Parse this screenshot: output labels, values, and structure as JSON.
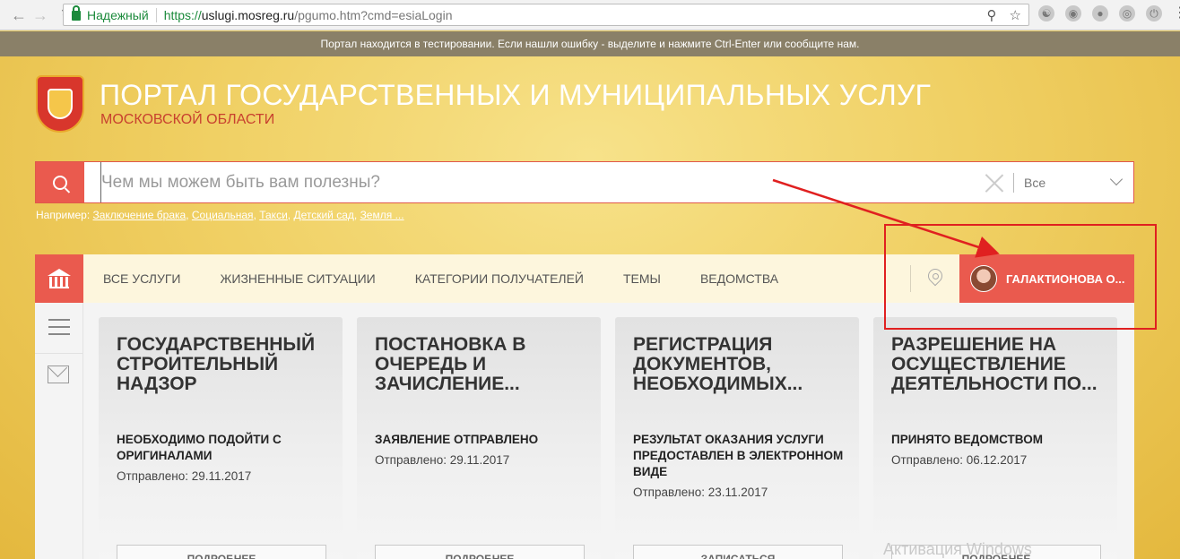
{
  "browser": {
    "secure_label": "Надежный",
    "url_scheme": "https://",
    "url_host": "uslugi.mosreg.ru",
    "url_path": "/pgumo.htm?cmd=esiaLogin"
  },
  "banner": {
    "text": "Портал находится в тестировании. Если нашли ошибку - выделите и нажмите Ctrl-Enter или сообщите нам."
  },
  "header": {
    "title": "ПОРТАЛ ГОСУДАРСТВЕННЫХ И МУНИЦИПАЛЬНЫХ УСЛУГ",
    "subtitle": "МОСКОВСКОЙ ОБЛАСТИ"
  },
  "search": {
    "placeholder": "Чем мы можем быть вам полезны?",
    "scope": "Все",
    "examples_prefix": "Например:",
    "examples": [
      "Заключение брака",
      "Социальная",
      "Такси",
      "Детский сад",
      "Земля ..."
    ]
  },
  "nav": {
    "items": [
      "ВСЕ УСЛУГИ",
      "ЖИЗНЕННЫЕ СИТУАЦИИ",
      "КАТЕГОРИИ ПОЛУЧАТЕЛЕЙ",
      "ТЕМЫ",
      "ВЕДОМСТВА"
    ],
    "user_name": "ГАЛАКТИОНОВА О..."
  },
  "cards": [
    {
      "title": "ГОСУДАРСТВЕННЫЙ СТРОИТЕЛЬНЫЙ НАДЗОР",
      "status": "НЕОБХОДИМО ПОДОЙТИ С ОРИГИНАЛАМИ",
      "date": "Отправлено: 29.11.2017",
      "button": "ПОДРОБНЕЕ"
    },
    {
      "title": "ПОСТАНОВКА В ОЧЕРЕДЬ И ЗАЧИСЛЕНИЕ...",
      "status": "ЗАЯВЛЕНИЕ ОТПРАВЛЕНО",
      "date": "Отправлено: 29.11.2017",
      "button": "ПОДРОБНЕЕ"
    },
    {
      "title": "РЕГИСТРАЦИЯ ДОКУМЕНТОВ, НЕОБХОДИМЫХ...",
      "status": "РЕЗУЛЬТАТ ОКАЗАНИЯ УСЛУГИ ПРЕДОСТАВЛЕН В ЭЛЕКТРОННОМ ВИДЕ",
      "date": "Отправлено: 23.11.2017",
      "button": "ЗАПИСАТЬСЯ"
    },
    {
      "title": "РАЗРЕШЕНИЕ НА ОСУЩЕСТВЛЕНИЕ ДЕЯТЕЛЬНОСТИ ПО...",
      "status": "ПРИНЯТО ВЕДОМСТВОМ",
      "date": "Отправлено: 06.12.2017",
      "button": "ПОДРОБНЕЕ"
    }
  ],
  "watermark": "Активация Windows",
  "colors": {
    "accent": "#ea5a4e",
    "annotation": "#e02020",
    "banner": "#8a8068"
  }
}
